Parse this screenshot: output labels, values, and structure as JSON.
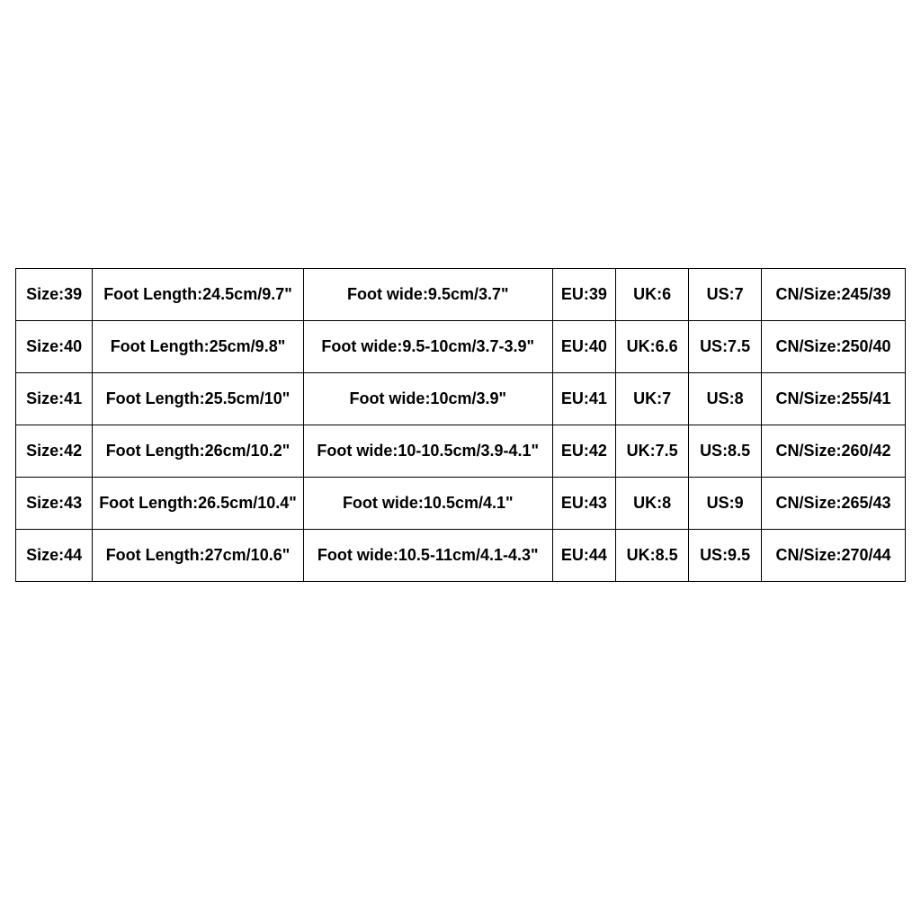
{
  "chart_data": {
    "type": "table",
    "title": "",
    "columns": [
      "Size",
      "Foot Length",
      "Foot wide",
      "EU",
      "UK",
      "US",
      "CN/Size"
    ],
    "rows": [
      {
        "size": "Size:39",
        "length": "Foot Length:24.5cm/9.7\"",
        "wide": "Foot wide:9.5cm/3.7\"",
        "eu": "EU:39",
        "uk": "UK:6",
        "us": "US:7",
        "cn": "CN/Size:245/39"
      },
      {
        "size": "Size:40",
        "length": "Foot Length:25cm/9.8\"",
        "wide": "Foot wide:9.5-10cm/3.7-3.9\"",
        "eu": "EU:40",
        "uk": "UK:6.6",
        "us": "US:7.5",
        "cn": "CN/Size:250/40"
      },
      {
        "size": "Size:41",
        "length": "Foot Length:25.5cm/10\"",
        "wide": "Foot wide:10cm/3.9\"",
        "eu": "EU:41",
        "uk": "UK:7",
        "us": "US:8",
        "cn": "CN/Size:255/41"
      },
      {
        "size": "Size:42",
        "length": "Foot Length:26cm/10.2\"",
        "wide": "Foot wide:10-10.5cm/3.9-4.1\"",
        "eu": "EU:42",
        "uk": "UK:7.5",
        "us": "US:8.5",
        "cn": "CN/Size:260/42"
      },
      {
        "size": "Size:43",
        "length": "Foot Length:26.5cm/10.4\"",
        "wide": "Foot wide:10.5cm/4.1\"",
        "eu": "EU:43",
        "uk": "UK:8",
        "us": "US:9",
        "cn": "CN/Size:265/43"
      },
      {
        "size": "Size:44",
        "length": "Foot Length:27cm/10.6\"",
        "wide": "Foot wide:10.5-11cm/4.1-4.3\"",
        "eu": "EU:44",
        "uk": "UK:8.5",
        "us": "US:9.5",
        "cn": "CN/Size:270/44"
      }
    ]
  }
}
